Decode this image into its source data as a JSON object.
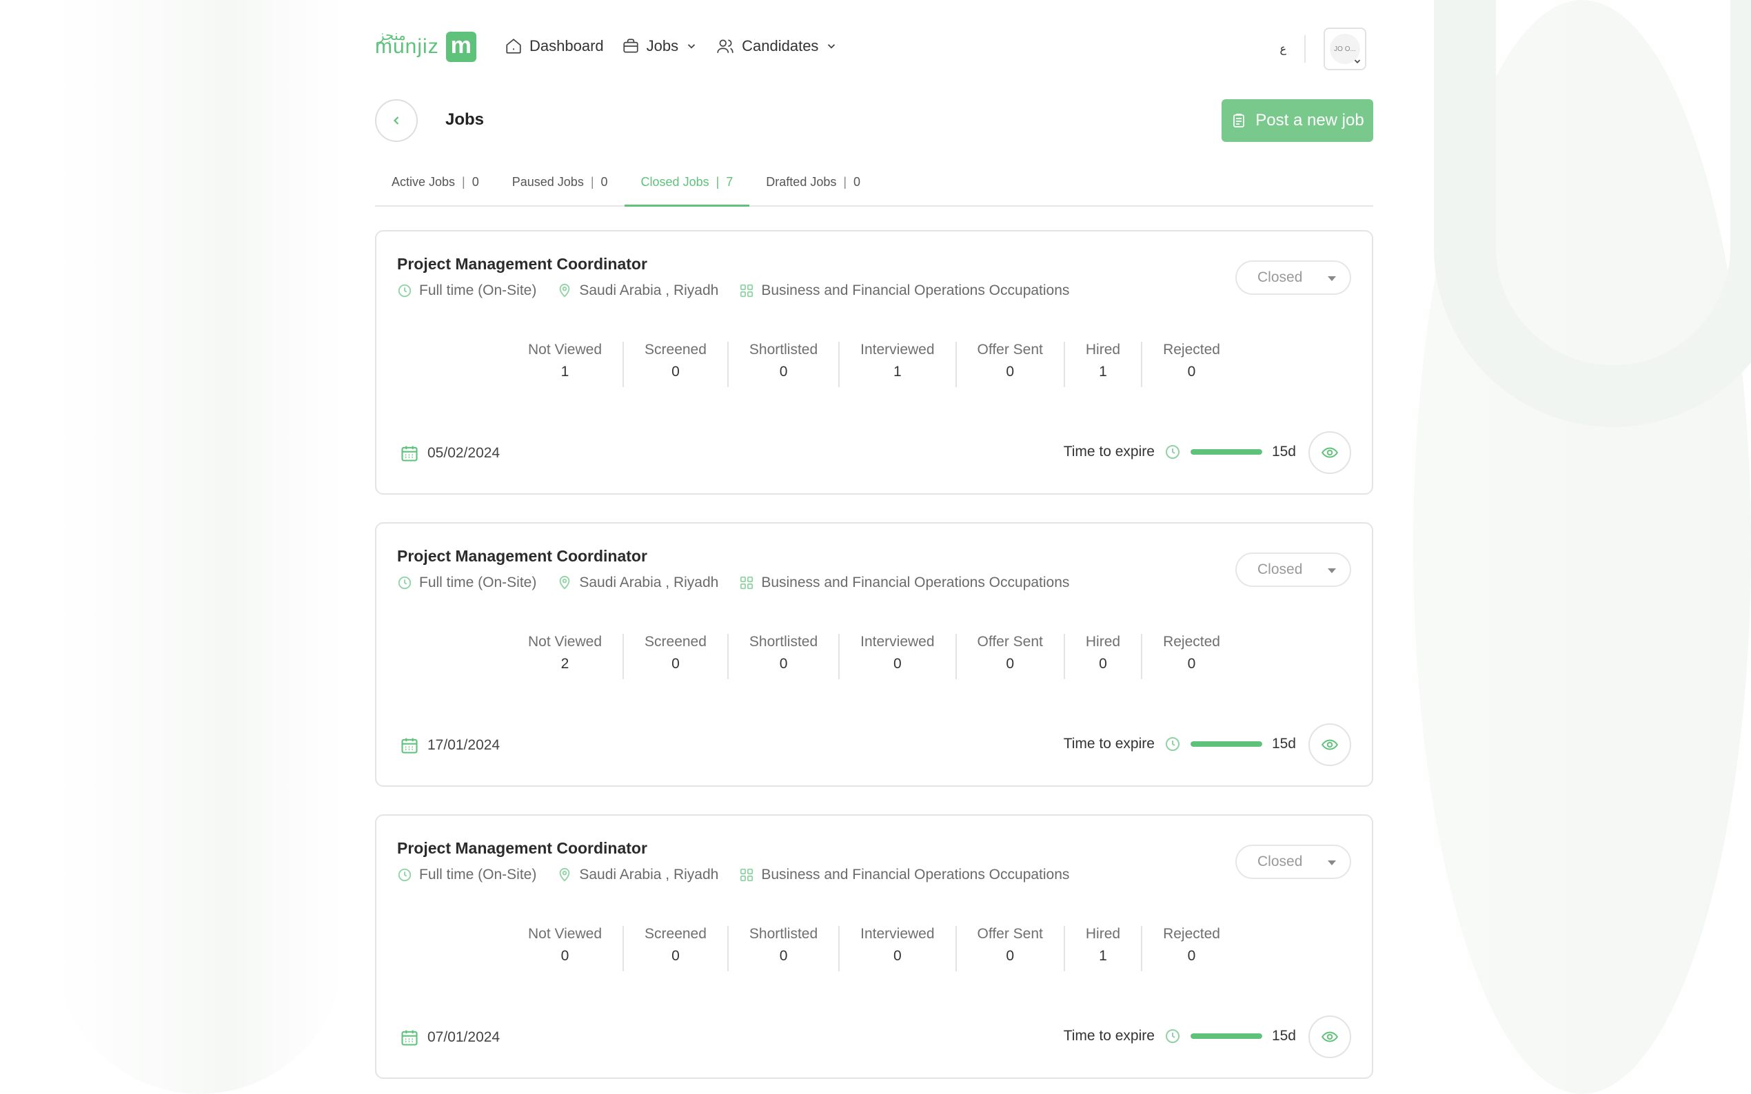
{
  "header": {
    "logo_text": "munjiz",
    "logo_arabic": "منجز",
    "nav": [
      {
        "label": "Dashboard",
        "icon": "home-icon"
      },
      {
        "label": "Jobs",
        "icon": "briefcase-icon",
        "has_dropdown": true
      },
      {
        "label": "Candidates",
        "icon": "users-icon",
        "has_dropdown": true
      }
    ],
    "language_label": "ع",
    "avatar_text": "JO O..."
  },
  "page": {
    "title": "Jobs",
    "post_button_label": "Post a new job"
  },
  "tabs": [
    {
      "label": "Active Jobs",
      "count": "0",
      "active": false
    },
    {
      "label": "Paused Jobs",
      "count": "0",
      "active": false
    },
    {
      "label": "Closed Jobs",
      "count": "7",
      "active": true
    },
    {
      "label": "Drafted Jobs",
      "count": "0",
      "active": false
    }
  ],
  "stat_labels": [
    "Not Viewed",
    "Screened",
    "Shortlisted",
    "Interviewed",
    "Offer Sent",
    "Hired",
    "Rejected"
  ],
  "expire_label": "Time to expire",
  "jobs": [
    {
      "title": "Project Management Coordinator",
      "employment": "Full time (On-Site)",
      "location": "Saudi Arabia , Riyadh",
      "category": "Business and Financial Operations Occupations",
      "status": "Closed",
      "stats": [
        "1",
        "0",
        "0",
        "1",
        "0",
        "1",
        "0"
      ],
      "date": "05/02/2024",
      "expire_value": "15d",
      "expire_fraction": 1.0
    },
    {
      "title": "Project Management Coordinator",
      "employment": "Full time (On-Site)",
      "location": "Saudi Arabia , Riyadh",
      "category": "Business and Financial Operations Occupations",
      "status": "Closed",
      "stats": [
        "2",
        "0",
        "0",
        "0",
        "0",
        "0",
        "0"
      ],
      "date": "17/01/2024",
      "expire_value": "15d",
      "expire_fraction": 1.0
    },
    {
      "title": "Project Management Coordinator",
      "employment": "Full time (On-Site)",
      "location": "Saudi Arabia , Riyadh",
      "category": "Business and Financial Operations Occupations",
      "status": "Closed",
      "stats": [
        "0",
        "0",
        "0",
        "0",
        "0",
        "1",
        "0"
      ],
      "date": "07/01/2024",
      "expire_value": "15d",
      "expire_fraction": 1.0
    }
  ],
  "colors": {
    "accent": "#5ec27b",
    "button": "#79c98d",
    "border": "#e4e4e4"
  }
}
